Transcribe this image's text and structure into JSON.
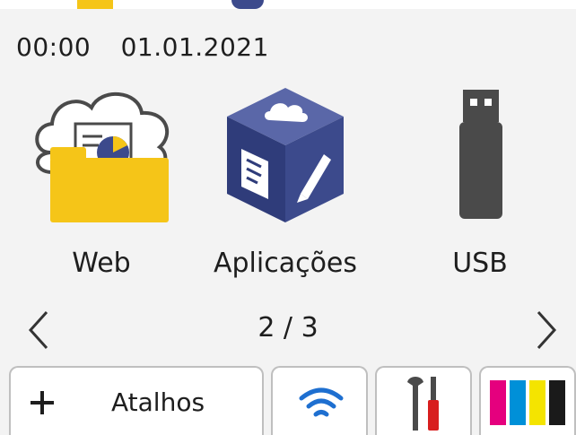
{
  "status": {
    "time": "00:00",
    "date": "01.01.2021"
  },
  "apps": [
    {
      "label": "Web",
      "icon": "web-folder-icon"
    },
    {
      "label": "Aplicações",
      "icon": "apps-cube-icon"
    },
    {
      "label": "USB",
      "icon": "usb-drive-icon"
    }
  ],
  "pager": {
    "indicator": "2 / 3"
  },
  "bottom_bar": {
    "shortcuts_label": "Atalhos",
    "shortcuts_icon": "plus-icon",
    "wifi_icon": "wifi-icon",
    "settings_icon": "tools-icon",
    "toner_icon": "ink-cartridges-icon"
  },
  "colors": {
    "folder_yellow": "#f5c518",
    "cube_blue": "#3c4a8c",
    "usb_gray": "#4a4a4a",
    "wifi_blue": "#1e6fd0",
    "ink_magenta": "#e5007e",
    "ink_cyan": "#0090d8",
    "ink_yellow": "#f4e400",
    "ink_black": "#1a1a1a"
  }
}
